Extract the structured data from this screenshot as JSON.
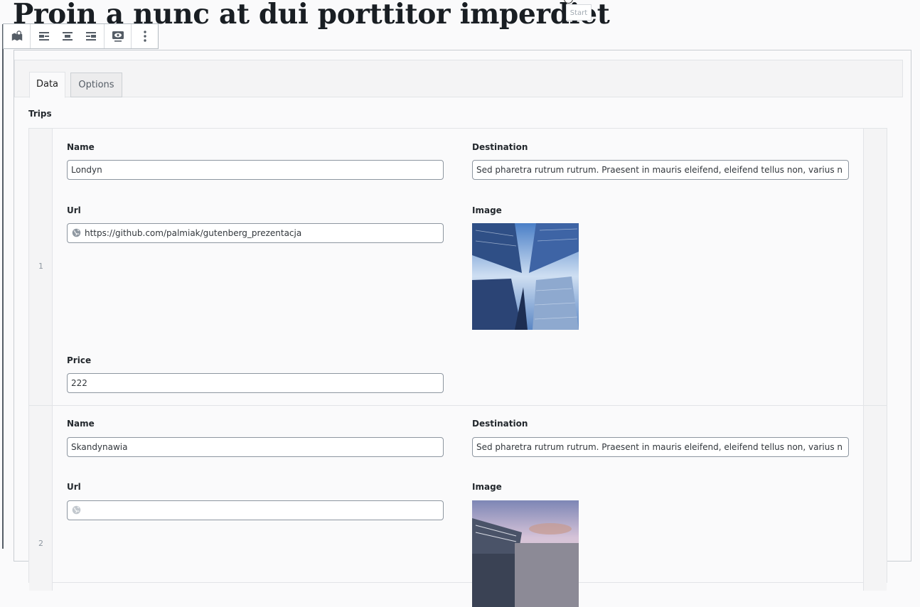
{
  "post": {
    "title": "Proin a nunc at dui porttitor imperdiet",
    "start_chip": "Start"
  },
  "toolbar": {
    "icons": [
      "map-marker-icon",
      "align-left-icon",
      "align-center-icon",
      "align-right-icon",
      "preview-icon",
      "more-options-icon"
    ]
  },
  "tabs": [
    {
      "label": "Data",
      "active": true
    },
    {
      "label": "Options",
      "active": false
    }
  ],
  "section": {
    "label": "Trips"
  },
  "trips": [
    {
      "index": "1",
      "name_label": "Name",
      "name_value": "Londyn",
      "destination_label": "Destination",
      "destination_value": "Sed pharetra rutrum rutrum. Praesent in mauris eleifend, eleifend tellus non, varius n",
      "url_label": "Url",
      "url_value": "https://github.com/palmiak/gutenberg_prezentacja",
      "image_label": "Image",
      "price_label": "Price",
      "price_value": "222"
    },
    {
      "index": "2",
      "name_label": "Name",
      "name_value": "Skandynawia",
      "destination_label": "Destination",
      "destination_value": "Sed pharetra rutrum rutrum. Praesent in mauris eleifend, eleifend tellus non, varius n",
      "url_label": "Url",
      "url_value": "",
      "image_label": "Image"
    }
  ],
  "colors": {
    "accent": "#191e23",
    "border": "#8d96a0",
    "panel": "#f4f4f5"
  }
}
